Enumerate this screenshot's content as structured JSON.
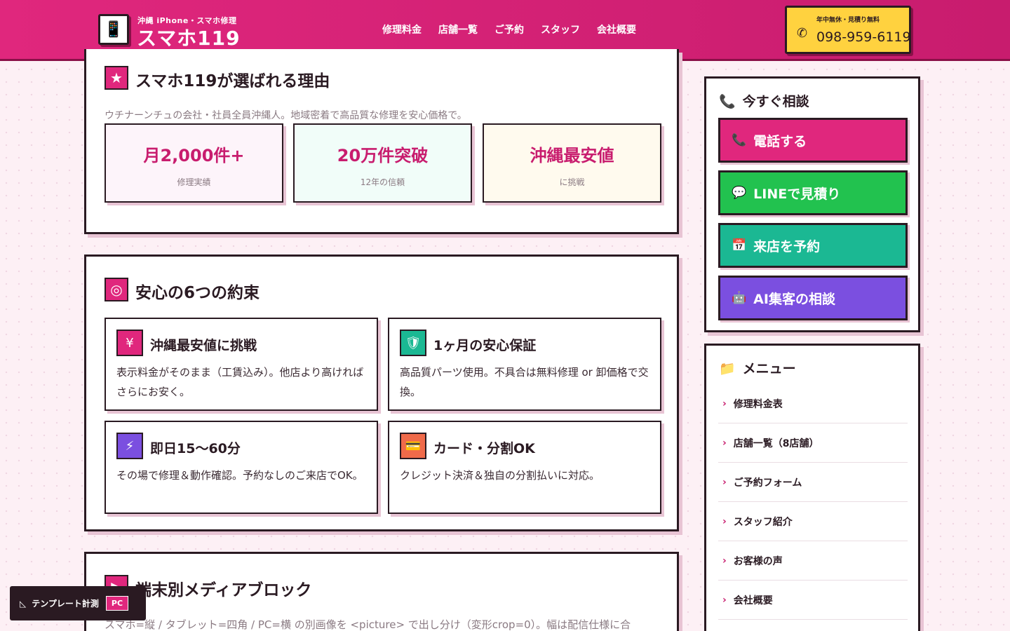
{
  "header": {
    "logo_icon": "phone-device-icon",
    "logo_sub": "沖縄 iPhone・スマホ修理",
    "logo_main": "スマホ119",
    "nav": [
      "修理料金",
      "店舗一覧",
      "ご予約",
      "スタッフ",
      "会社概要"
    ],
    "phone_note": "年中無休・見積り無料",
    "phone_number": "098-959-6119",
    "phone_icon": "phone-icon"
  },
  "reasons": {
    "icon": "star-icon",
    "title": "スマホ119が選ばれる理由",
    "desc": "ウチナーンチュの会社・社員全員沖縄人。地域密着で高品質な修理を安心価格で。",
    "stats": [
      {
        "value": "月2,000件+",
        "sub": "修理実績",
        "bg": "#fdf4fa"
      },
      {
        "value": "20万件突破",
        "sub": "12年の信頼",
        "bg": "#f1fdf9"
      },
      {
        "value": "沖縄最安値",
        "sub": "に挑戦",
        "bg": "#fffaee"
      }
    ]
  },
  "promises": {
    "icon": "target-icon",
    "title": "安心の6つの約束",
    "items": [
      {
        "icon": "yen-icon",
        "glyph": "¥",
        "color": "#e0277d",
        "title": "沖縄最安値に挑戦",
        "desc": "表示料金がそのまま（工賃込み）。他店より高ければさらにお安く。"
      },
      {
        "icon": "shield-icon",
        "glyph": "🛡",
        "color": "#1bb893",
        "title": "1ヶ月の安心保証",
        "desc": "高品質パーツ使用。不具合は無料修理 or 卸価格で交換。"
      },
      {
        "icon": "lightning-icon",
        "glyph": "⚡",
        "color": "#7b4fe0",
        "title": "即日15〜60分",
        "desc": "その場で修理＆動作確認。予約なしのご来店でOK。"
      },
      {
        "icon": "card-icon",
        "glyph": "💳",
        "color": "#f06a4a",
        "title": "カード・分割OK",
        "desc": "クレジット決済＆独自の分割払いに対応。"
      }
    ]
  },
  "media": {
    "icon": "play-icon",
    "title": "端末別メディアブロック",
    "desc": "スマホ=縦 / タブレット=四角 / PC=横 の別画像を <picture> で出し分け（変形crop=0）。幅は配信仕様に合"
  },
  "consult": {
    "icon": "phone-icon",
    "title": "今すぐ相談",
    "buttons": [
      {
        "icon": "phone-icon",
        "glyph": "📞",
        "label": "電話する",
        "color": "#e0277d"
      },
      {
        "icon": "chat-bubble-icon",
        "glyph": "💬",
        "label": "LINEで見積り",
        "color": "#22c24f"
      },
      {
        "icon": "calendar-icon",
        "glyph": "📅",
        "label": "来店を予約",
        "color": "#1bb893"
      },
      {
        "icon": "robot-icon",
        "glyph": "🤖",
        "label": "AI集客の相談",
        "color": "#7b4fe0"
      }
    ]
  },
  "menu": {
    "icon": "folder-icon",
    "title": "メニュー",
    "items": [
      "修理料金表",
      "店舗一覧（8店舗）",
      "ご予約フォーム",
      "スタッフ紹介",
      "お客様の声",
      "会社概要"
    ]
  },
  "badge": {
    "icon": "ruler-icon",
    "label": "テンプレート計測",
    "tag": "PC"
  }
}
